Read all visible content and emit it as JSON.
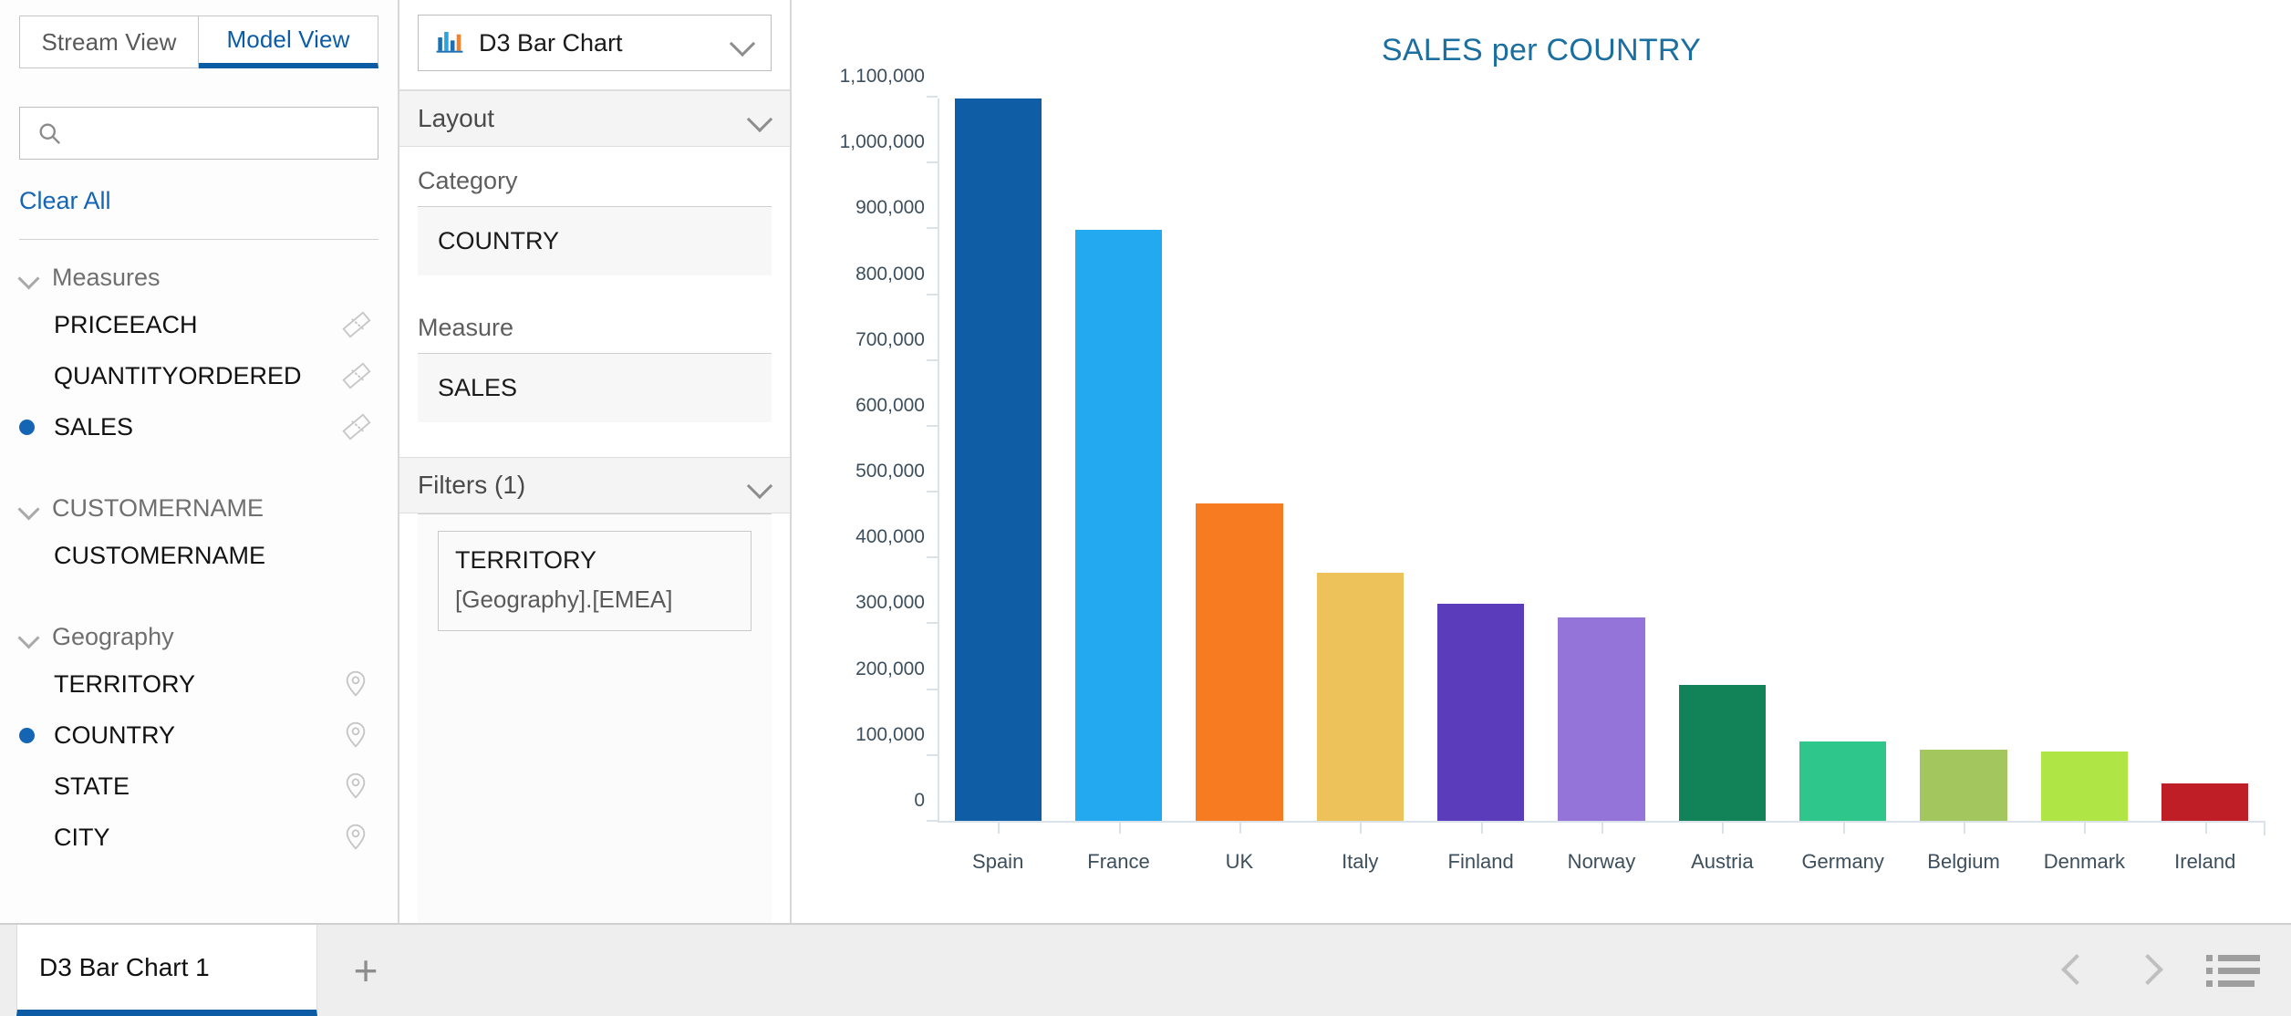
{
  "left_panel": {
    "tabs": [
      {
        "label": "Stream View",
        "active": false
      },
      {
        "label": "Model View",
        "active": true
      }
    ],
    "search": {
      "placeholder": "",
      "value": "",
      "icon": "search-icon"
    },
    "clear_all_label": "Clear All",
    "groups": [
      {
        "name": "Measures",
        "expanded": true,
        "fields": [
          {
            "label": "PRICEEACH",
            "icon": "ruler-icon",
            "selected": false
          },
          {
            "label": "QUANTITYORDERED",
            "icon": "ruler-icon",
            "selected": false
          },
          {
            "label": "SALES",
            "icon": "ruler-icon",
            "selected": true
          }
        ]
      },
      {
        "name": "CUSTOMERNAME",
        "expanded": true,
        "fields": [
          {
            "label": "CUSTOMERNAME",
            "icon": "",
            "selected": false
          }
        ]
      },
      {
        "name": "Geography",
        "expanded": true,
        "fields": [
          {
            "label": "TERRITORY",
            "icon": "map-pin-icon",
            "selected": false
          },
          {
            "label": "COUNTRY",
            "icon": "map-pin-icon",
            "selected": true
          },
          {
            "label": "STATE",
            "icon": "map-pin-icon",
            "selected": false
          },
          {
            "label": "CITY",
            "icon": "map-pin-icon",
            "selected": false
          }
        ]
      }
    ]
  },
  "mid_panel": {
    "chart_type_select": {
      "label": "D3 Bar Chart",
      "icon": "bar-chart-icon"
    },
    "layout_section": {
      "title": "Layout",
      "category_label": "Category",
      "category_value": "COUNTRY",
      "measure_label": "Measure",
      "measure_value": "SALES"
    },
    "filters_section": {
      "title": "Filters (1)",
      "filters": [
        {
          "name": "TERRITORY",
          "value": "[Geography].[EMEA]"
        }
      ]
    }
  },
  "bottom_bar": {
    "doc_tab_label": "D3 Bar Chart 1",
    "add_tab_label": "+",
    "prev_label": "",
    "next_label": "",
    "list_label": ""
  },
  "colors": {
    "accent_blue": "#0b5ca5",
    "link_blue": "#1565b5",
    "title_blue": "#1b6ea0"
  },
  "chart_data": {
    "type": "bar",
    "title": "SALES per COUNTRY",
    "xlabel": "",
    "ylabel": "",
    "categories": [
      "Spain",
      "France",
      "UK",
      "Italy",
      "Finland",
      "Norway",
      "Austria",
      "Germany",
      "Belgium",
      "Denmark",
      "Ireland"
    ],
    "values": [
      1145000,
      900000,
      484000,
      378000,
      331000,
      310000,
      207000,
      121000,
      108000,
      105000,
      57000
    ],
    "colors": [
      "#0f5ea5",
      "#22a9ef",
      "#f77b21",
      "#eec25a",
      "#5b3dbb",
      "#9574da",
      "#128358",
      "#2ec68b",
      "#a3c75e",
      "#b0e546",
      "#bf1e26"
    ],
    "ylim": [
      0,
      1100000
    ],
    "yticks": [
      0,
      100000,
      200000,
      300000,
      400000,
      500000,
      600000,
      700000,
      800000,
      900000,
      1000000,
      1100000
    ],
    "ytick_labels": [
      "0",
      "100,000",
      "200,000",
      "300,000",
      "400,000",
      "500,000",
      "600,000",
      "700,000",
      "800,000",
      "900,000",
      "1,000,000",
      "1,100,000"
    ],
    "grid": false,
    "legend": "none"
  }
}
